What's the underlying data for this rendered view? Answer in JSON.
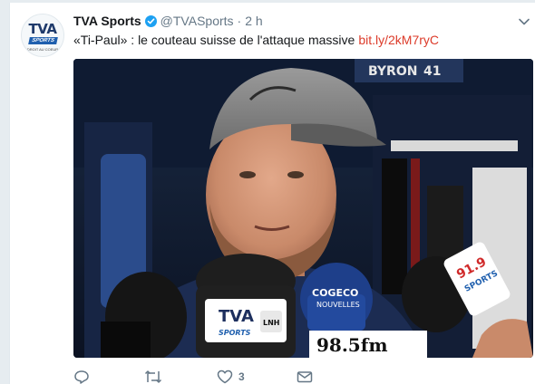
{
  "tweet": {
    "display_name": "TVA Sports",
    "handle": "@TVASports",
    "separator": "·",
    "timestamp": "2 h",
    "text": "«Ti-Paul» : le couteau suisse de l'attaque massive",
    "link_text": "bit.ly/2kM7ryC",
    "link_color": "#dc3b2a"
  },
  "avatar": {
    "logo_text": "TVA",
    "logo_subtext": "SPORTS",
    "tagline": "DROIT AU COEUR"
  },
  "media": {
    "locker_nameplate": "BYRON",
    "locker_number": "41",
    "mic_tva_brand": "TVA",
    "mic_tva_sub": "SPORTS",
    "mic_lnh_badge": "LNH",
    "mic_cogeco_brand": "COGECO",
    "mic_cogeco_sub": "NOUVELLES",
    "mic_radio_freq": "98.5fm",
    "mic_91_9_freq": "91.9",
    "mic_91_9_sub": "SPORTS"
  },
  "actions": {
    "reply_icon": "reply-icon",
    "retweet_icon": "retweet-icon",
    "like_icon": "heart-icon",
    "like_count": "3",
    "dm_icon": "envelope-icon"
  },
  "colors": {
    "page_bg": "#e6ecf0",
    "card_bg": "#ffffff",
    "name": "#14171a",
    "muted": "#657786",
    "verified": "#1da1f2"
  }
}
